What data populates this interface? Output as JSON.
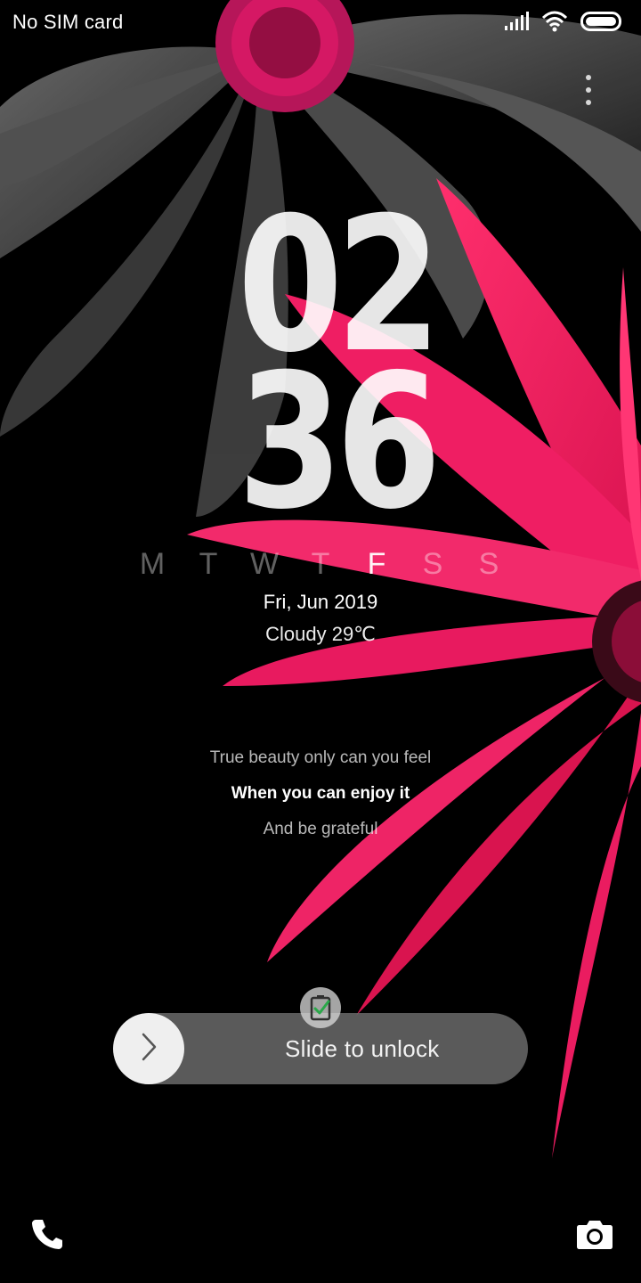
{
  "status_bar": {
    "carrier": "No SIM card",
    "icons": [
      "signal-icon",
      "wifi-icon",
      "battery-icon"
    ]
  },
  "menu": {
    "icon": "more-vertical-icon"
  },
  "clock": {
    "hours": "02",
    "minutes": "36"
  },
  "weekdays": {
    "days": [
      "M",
      "T",
      "W",
      "T",
      "F",
      "S",
      "S"
    ],
    "active_index": 4
  },
  "date": "Fri, Jun 2019",
  "weather": "Cloudy 29℃",
  "quote": {
    "line1": "True beauty only can you feel",
    "line2": "When you can enjoy it",
    "line3": "And be grateful"
  },
  "unlock": {
    "label": "Slide to unlock",
    "knob_icon": "chevron-right-icon",
    "badge_icon": "battery-charging-icon"
  },
  "shortcuts": {
    "left_icon": "phone-icon",
    "right_icon": "camera-icon"
  },
  "colors": {
    "flower_pink": "#e8175d",
    "flower_center": "#c21057",
    "petal_gray": "#4a4a4a",
    "background": "#000000"
  }
}
